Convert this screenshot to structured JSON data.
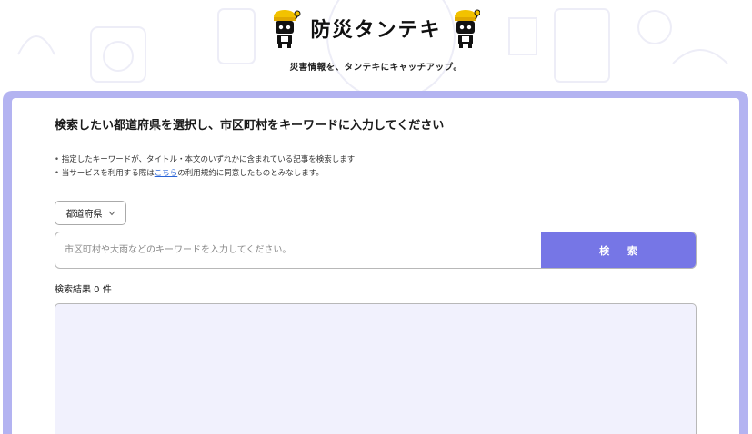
{
  "header": {
    "logo_text": "防災タンテキ",
    "tagline": "災害情報を、タンテキにキャッチアップ。"
  },
  "main": {
    "heading": "検索したい都道府県を選択し、市区町村をキーワードに入力してください",
    "note1": "指定したキーワードが、タイトル・本文のいずれかに含まれている記事を検索します",
    "note2_before": "当サービスを利用する際は",
    "note2_link": "こちら",
    "note2_after": "の利用規約に同意したものとみなします。",
    "prefecture_select": "都道府県",
    "search_placeholder": "市区町村や大雨などのキーワードを入力してください。",
    "search_value": "",
    "search_button": "検 索",
    "result_count": "検索結果 0 件"
  },
  "colors": {
    "accent": "#7676e6",
    "frame": "#b3b3f1",
    "results_bg": "#f1f1fd"
  },
  "icons": {
    "mascot": "robot-mascot-icon",
    "chevron": "chevron-down-icon"
  }
}
